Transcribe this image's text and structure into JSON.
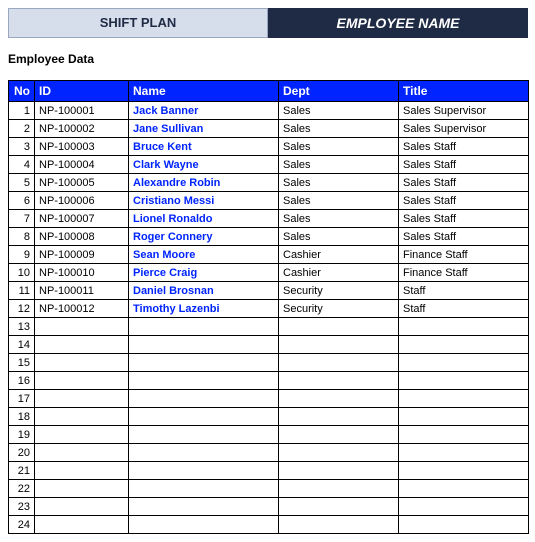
{
  "tabs": {
    "shift": "SHIFT PLAN",
    "employee": "EMPLOYEE NAME"
  },
  "section_label": "Employee Data",
  "columns": {
    "no": "No",
    "id": "ID",
    "name": "Name",
    "dept": "Dept",
    "title": "Title"
  },
  "total_rows": 24,
  "rows": [
    {
      "no": 1,
      "id": "NP-100001",
      "name": "Jack Banner",
      "dept": "Sales",
      "title": "Sales Supervisor"
    },
    {
      "no": 2,
      "id": "NP-100002",
      "name": "Jane Sullivan",
      "dept": "Sales",
      "title": "Sales Supervisor"
    },
    {
      "no": 3,
      "id": "NP-100003",
      "name": "Bruce Kent",
      "dept": "Sales",
      "title": "Sales Staff"
    },
    {
      "no": 4,
      "id": "NP-100004",
      "name": "Clark Wayne",
      "dept": "Sales",
      "title": "Sales Staff"
    },
    {
      "no": 5,
      "id": "NP-100005",
      "name": "Alexandre Robin",
      "dept": "Sales",
      "title": "Sales Staff"
    },
    {
      "no": 6,
      "id": "NP-100006",
      "name": "Cristiano Messi",
      "dept": "Sales",
      "title": "Sales Staff"
    },
    {
      "no": 7,
      "id": "NP-100007",
      "name": "Lionel Ronaldo",
      "dept": "Sales",
      "title": "Sales Staff"
    },
    {
      "no": 8,
      "id": "NP-100008",
      "name": "Roger Connery",
      "dept": "Sales",
      "title": "Sales Staff"
    },
    {
      "no": 9,
      "id": "NP-100009",
      "name": "Sean Moore",
      "dept": "Cashier",
      "title": "Finance Staff"
    },
    {
      "no": 10,
      "id": "NP-100010",
      "name": "Pierce Craig",
      "dept": "Cashier",
      "title": "Finance Staff"
    },
    {
      "no": 11,
      "id": "NP-100011",
      "name": "Daniel Brosnan",
      "dept": "Security",
      "title": "Staff"
    },
    {
      "no": 12,
      "id": "NP-100012",
      "name": "Timothy Lazenbi",
      "dept": "Security",
      "title": "Staff"
    }
  ]
}
